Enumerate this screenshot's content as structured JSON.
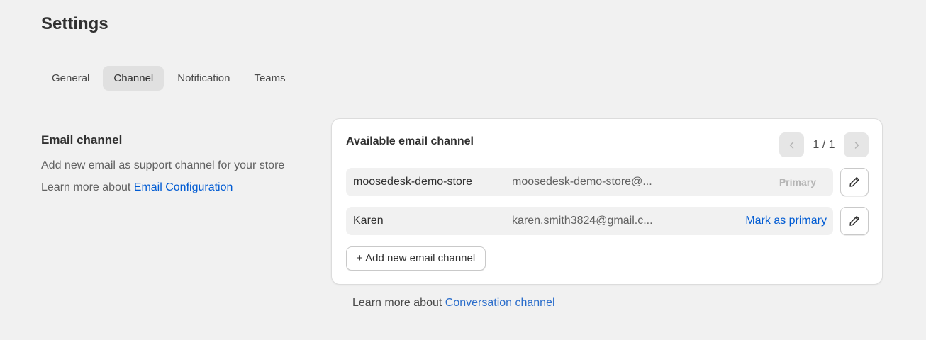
{
  "page": {
    "title": "Settings"
  },
  "tabs": [
    {
      "label": "General",
      "active": false
    },
    {
      "label": "Channel",
      "active": true
    },
    {
      "label": "Notification",
      "active": false
    },
    {
      "label": "Teams",
      "active": false
    }
  ],
  "email_section": {
    "title": "Email channel",
    "description": "Add new email as support channel for your store",
    "learn_prefix": "Learn more about",
    "learn_link": "Email Configuration"
  },
  "card": {
    "title": "Available email channel",
    "pagination": {
      "text": "1 / 1",
      "prev_icon": "chevron-left-icon",
      "next_icon": "chevron-right-icon"
    },
    "rows": [
      {
        "name": "moosedesk-demo-store",
        "email": "moosedesk-demo-store@...",
        "status": "Primary",
        "edit_icon": "pencil-icon"
      },
      {
        "name": "Karen",
        "email": "karen.smith3824@gmail.c...",
        "action": "Mark as primary",
        "edit_icon": "pencil-icon"
      }
    ],
    "add_button": "+ Add new email channel"
  },
  "footer": {
    "learn_prefix": "Learn more about",
    "learn_link": "Conversation channel"
  },
  "colors": {
    "link": "#005bd3",
    "background": "#f1f1f1",
    "card": "#ffffff"
  }
}
